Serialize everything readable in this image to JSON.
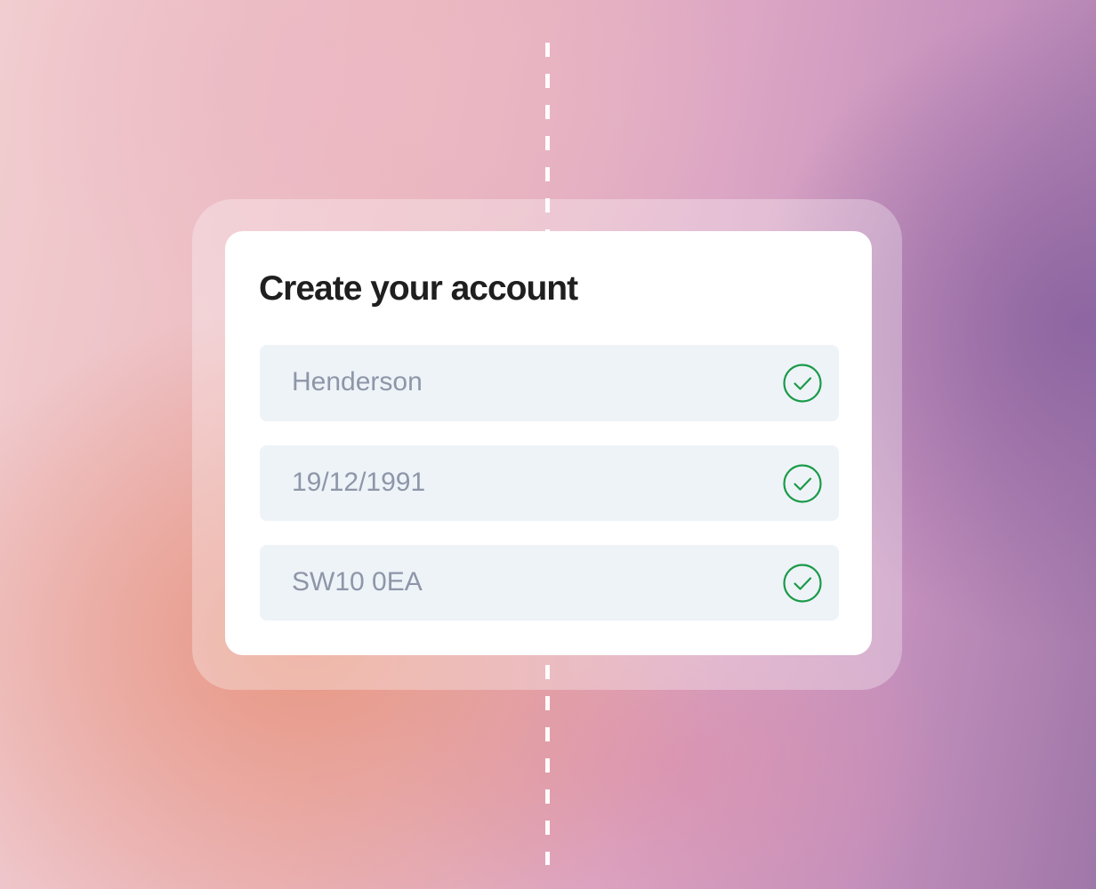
{
  "form": {
    "title": "Create your account",
    "fields": [
      {
        "value": "Henderson",
        "status_icon": "check-circle-icon"
      },
      {
        "value": "19/12/1991",
        "status_icon": "check-circle-icon"
      },
      {
        "value": "SW10 0EA",
        "status_icon": "check-circle-icon"
      }
    ]
  },
  "colors": {
    "success": "#1a9a48",
    "field_background": "#eef3f8",
    "field_text": "#8e96a8",
    "title_text": "#1f1f1f"
  }
}
